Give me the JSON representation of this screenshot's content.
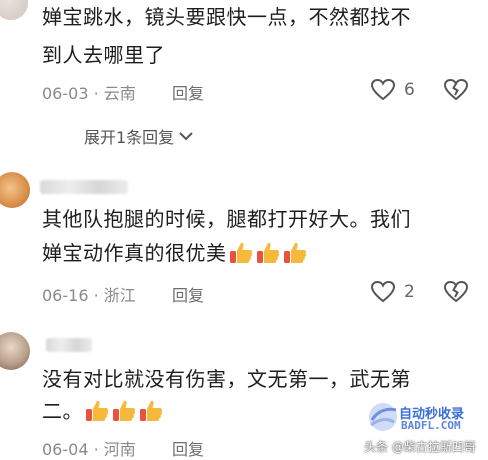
{
  "comments": [
    {
      "text_line1": "婵宝跳水，镜头要跟快一点，不然都找不",
      "text_line2": "到人去哪里了",
      "date": "06-03",
      "location": "云南",
      "reply_label": "回复",
      "like_count": "6",
      "expand_replies": "展开1条回复"
    },
    {
      "text_line1": "其他队抱腿的时候，腿都打开好大。我们",
      "text_line2": "婵宝动作真的很优美",
      "date": "06-16",
      "location": "浙江",
      "reply_label": "回复",
      "like_count": "2",
      "emoji": "thumbs-up x3"
    },
    {
      "text_line1": "没有对比就没有伤害，文无第一，武无第",
      "text_line2": "二。",
      "date": "06-04",
      "location": "河南",
      "reply_label": "回复",
      "emoji": "thumbs-up x3"
    }
  ],
  "separator": "·",
  "watermark": {
    "brand_cn": "自动秒收录",
    "brand_en": "BADFL.COM",
    "credit": "头条 @柴古拉斯凹哥"
  },
  "colors": {
    "text": "#1e1e1e",
    "meta": "#8a8a8a",
    "thumb_yellow": "#f6b93b",
    "thumb_red": "#e8533f",
    "watermark_blue": "#3b6fd8"
  },
  "icons": [
    "heart-outline-icon",
    "broken-heart-icon",
    "chevron-down-icon",
    "thumbs-up-emoji"
  ]
}
